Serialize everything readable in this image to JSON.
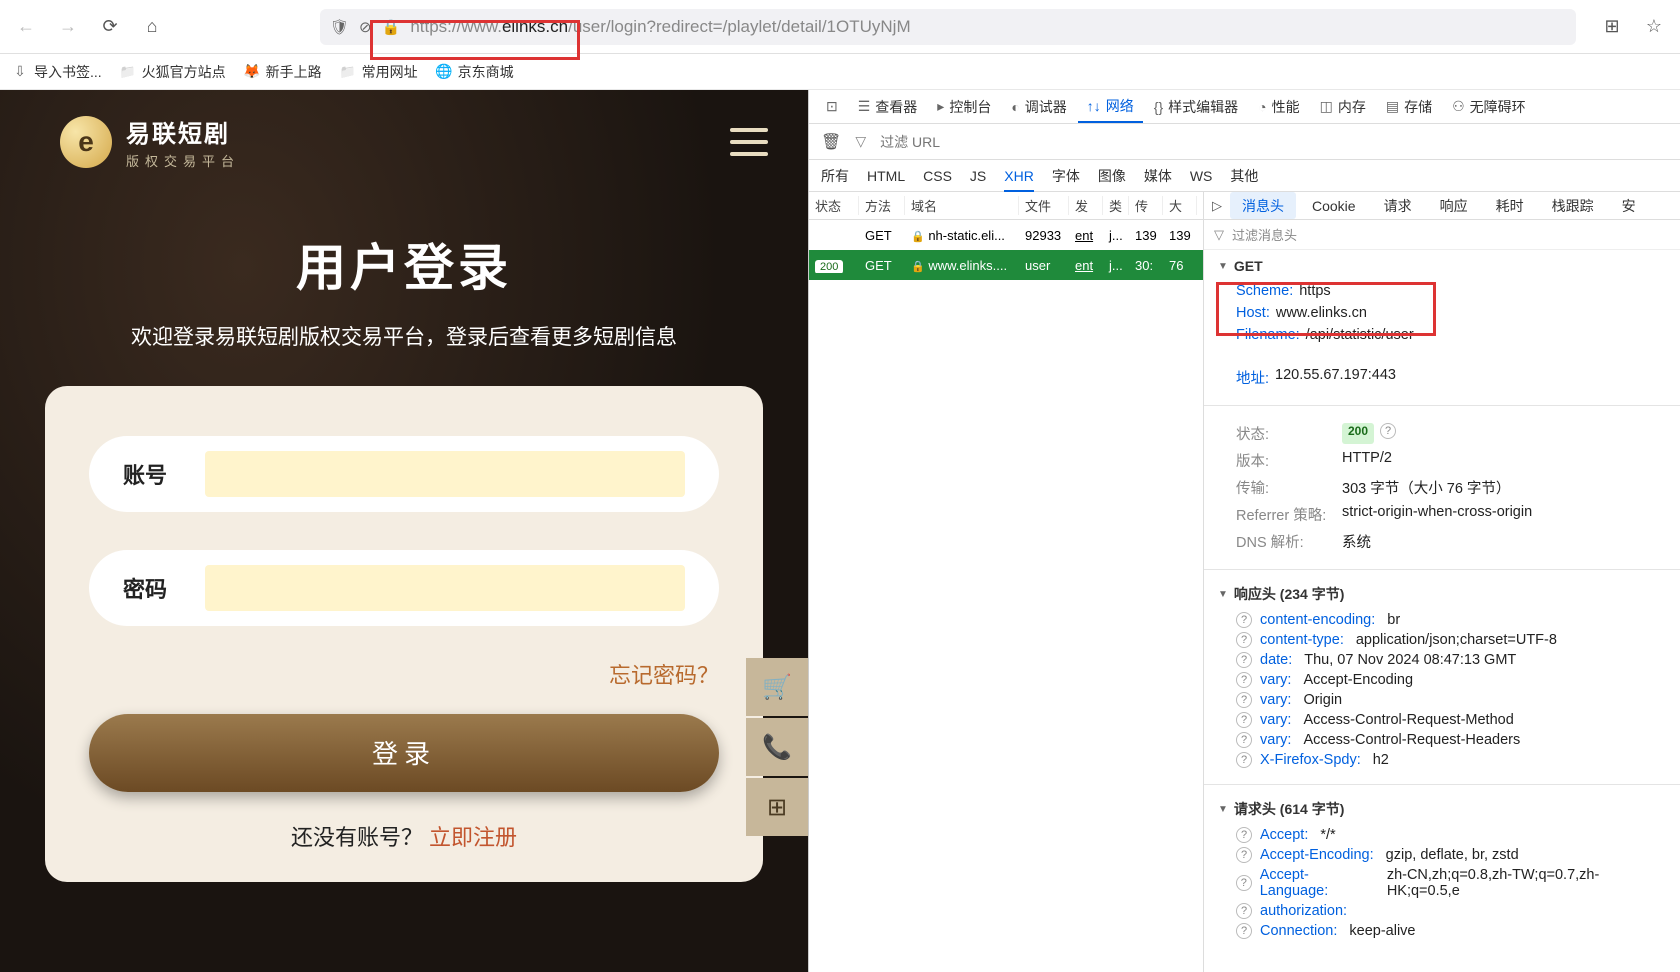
{
  "browser": {
    "url_prefix": "https://www.",
    "url_domain": "elinks.cn",
    "url_path": "/user/login?redirect=/playlet/detail/1OTUyNjM"
  },
  "bookmarks": {
    "import": "导入书签...",
    "fox": "火狐官方站点",
    "newbie": "新手上路",
    "common": "常用网址",
    "jd": "京东商城"
  },
  "login": {
    "logo_letter": "e",
    "logo_title": "易联短剧",
    "logo_sub": "版权交易平台",
    "title": "用户登录",
    "subtitle": "欢迎登录易联短剧版权交易平台，登录后查看更多短剧信息",
    "account_label": "账号",
    "password_label": "密码",
    "forgot": "忘记密码？",
    "login_btn": "登录",
    "no_account": "还没有账号？",
    "register": "立即注册"
  },
  "devtools": {
    "tabs": {
      "inspector": "查看器",
      "console": "控制台",
      "debugger": "调试器",
      "network": "网络",
      "style": "样式编辑器",
      "performance": "性能",
      "memory": "内存",
      "storage": "存储",
      "a11y": "无障碍环"
    },
    "filter_placeholder": "过滤 URL",
    "types": {
      "all": "所有",
      "html": "HTML",
      "css": "CSS",
      "js": "JS",
      "xhr": "XHR",
      "fonts": "字体",
      "images": "图像",
      "media": "媒体",
      "ws": "WS",
      "other": "其他"
    },
    "columns": {
      "status": "状态",
      "method": "方法",
      "domain": "域名",
      "file": "文件",
      "initiator": "发",
      "type": "类",
      "transferred": "传",
      "size": "大"
    },
    "requests": [
      {
        "status": "",
        "method": "GET",
        "domain": "nh-static.eli...",
        "file": "92933",
        "init": "ent",
        "type": "j...",
        "trans": "139",
        "size": "139"
      },
      {
        "status": "200",
        "method": "GET",
        "domain": "www.elinks....",
        "file": "user",
        "init": "ent",
        "type": "j...",
        "trans": "30:",
        "size": "76"
      }
    ],
    "detail_tabs": {
      "headers": "消息头",
      "cookie": "Cookie",
      "request": "请求",
      "response": "响应",
      "timing": "耗时",
      "stack": "栈跟踪",
      "security": "安"
    },
    "filter_headers": "过滤消息头",
    "get_section": {
      "title": "GET",
      "scheme_k": "Scheme",
      "scheme_v": "https",
      "host_k": "Host",
      "host_v": "www.elinks.cn",
      "filename_k": "Filename",
      "filename_v": "/api/statistic/user",
      "address_k": "地址",
      "address_v": "120.55.67.197:443"
    },
    "meta": {
      "status_k": "状态",
      "status_v": "200",
      "version_k": "版本",
      "version_v": "HTTP/2",
      "transfer_k": "传输",
      "transfer_v": "303 字节（大小 76 字节）",
      "referrer_k": "Referrer 策略",
      "referrer_v": "strict-origin-when-cross-origin",
      "dns_k": "DNS 解析",
      "dns_v": "系统"
    },
    "response_headers": {
      "title": "响应头 (234 字节)",
      "items": [
        {
          "k": "content-encoding",
          "v": "br"
        },
        {
          "k": "content-type",
          "v": "application/json;charset=UTF-8"
        },
        {
          "k": "date",
          "v": "Thu, 07 Nov 2024 08:47:13 GMT"
        },
        {
          "k": "vary",
          "v": "Accept-Encoding"
        },
        {
          "k": "vary",
          "v": "Origin"
        },
        {
          "k": "vary",
          "v": "Access-Control-Request-Method"
        },
        {
          "k": "vary",
          "v": "Access-Control-Request-Headers"
        },
        {
          "k": "X-Firefox-Spdy",
          "v": "h2"
        }
      ]
    },
    "request_headers": {
      "title": "请求头 (614 字节)",
      "items": [
        {
          "k": "Accept",
          "v": "*/*"
        },
        {
          "k": "Accept-Encoding",
          "v": "gzip, deflate, br, zstd"
        },
        {
          "k": "Accept-Language",
          "v": "zh-CN,zh;q=0.8,zh-TW;q=0.7,zh-HK;q=0.5,e"
        },
        {
          "k": "authorization",
          "v": ""
        },
        {
          "k": "Connection",
          "v": "keep-alive"
        }
      ]
    }
  }
}
